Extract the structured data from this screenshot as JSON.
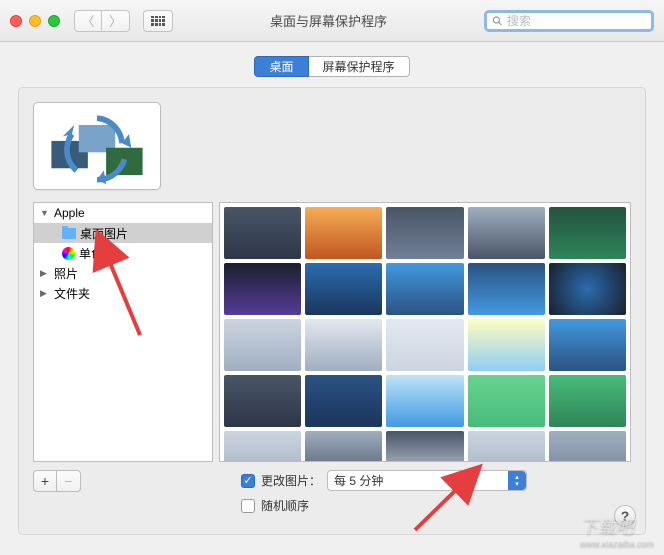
{
  "titlebar": {
    "title": "桌面与屏幕保护程序"
  },
  "search": {
    "placeholder": "搜索"
  },
  "tabs": {
    "desktop": "桌面",
    "screensaver": "屏幕保护程序"
  },
  "sidebar": {
    "items": [
      {
        "label": "Apple",
        "expanded": true,
        "level": 0
      },
      {
        "label": "桌面图片",
        "selected": true,
        "icon": "folder",
        "level": 1
      },
      {
        "label": "单色",
        "icon": "color-wheel",
        "level": 1
      },
      {
        "label": "照片",
        "expanded": false,
        "level": 0
      },
      {
        "label": "文件夹",
        "expanded": false,
        "level": 0
      }
    ]
  },
  "controls": {
    "add": "+",
    "remove": "−",
    "change_picture_label": "更改图片：",
    "interval_selected": "每 5 分钟",
    "random_order_label": "随机顺序"
  },
  "watermark": {
    "main": "下载吧",
    "sub": "www.xiazaiba.com"
  }
}
